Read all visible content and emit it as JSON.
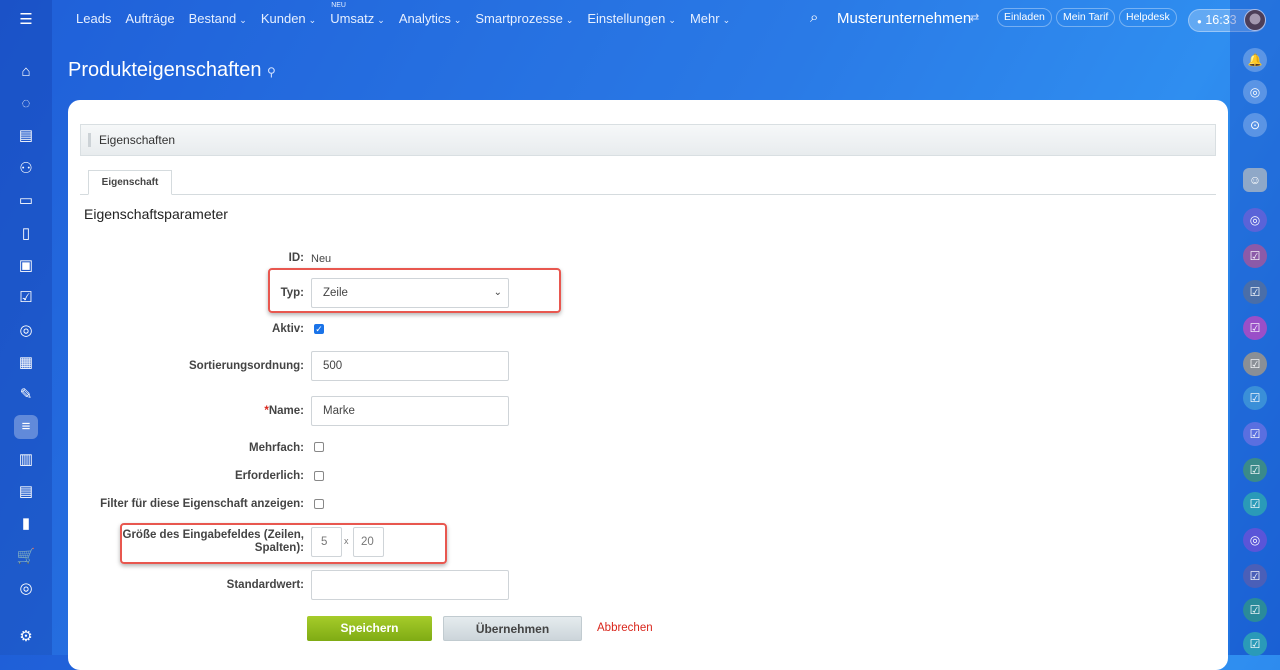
{
  "topbar": {
    "nav": [
      {
        "label": "Leads",
        "chevron": false
      },
      {
        "label": "Aufträge",
        "chevron": false
      },
      {
        "label": "Bestand",
        "chevron": true
      },
      {
        "label": "Kunden",
        "chevron": true
      },
      {
        "label": "Umsatz",
        "chevron": true,
        "badge": "NEU"
      },
      {
        "label": "Analytics",
        "chevron": true
      },
      {
        "label": "Smartprozesse",
        "chevron": true
      },
      {
        "label": "Einstellungen",
        "chevron": true
      },
      {
        "label": "Mehr",
        "chevron": true
      }
    ],
    "company": "Musterunternehmen",
    "buttons": [
      "Einladen",
      "Mein Tarif",
      "Helpdesk"
    ],
    "time": "16:33"
  },
  "page": {
    "title": "Produkteigenschaften"
  },
  "panel": {
    "header": "Eigenschaften",
    "tab": "Eigenschaft",
    "section": "Eigenschaftsparameter"
  },
  "form": {
    "id_label": "ID:",
    "id_value": "Neu",
    "type_label": "Typ:",
    "type_value": "Zeile",
    "active_label": "Aktiv:",
    "active": true,
    "sort_label": "Sortierungsordnung:",
    "sort_value": "500",
    "name_required": "*",
    "name_label": "Name:",
    "name_value": "Marke",
    "multiple_label": "Mehrfach:",
    "multiple": false,
    "required_label": "Erforderlich:",
    "required": false,
    "filter_label": "Filter für diese Eigenschaft anzeigen:",
    "filter": false,
    "size_label_1": "Größe des Eingabefeldes (Zeilen,",
    "size_label_2": "Spalten):",
    "rows": "5",
    "size_sep": "x",
    "cols": "20",
    "default_label": "Standardwert:",
    "default_value": ""
  },
  "actions": {
    "save": "Speichern",
    "apply": "Übernehmen",
    "cancel": "Abbrechen"
  },
  "colors": {
    "highlight": "#e8574f",
    "save": "#8dbb1c",
    "cancel": "#d9261c"
  }
}
